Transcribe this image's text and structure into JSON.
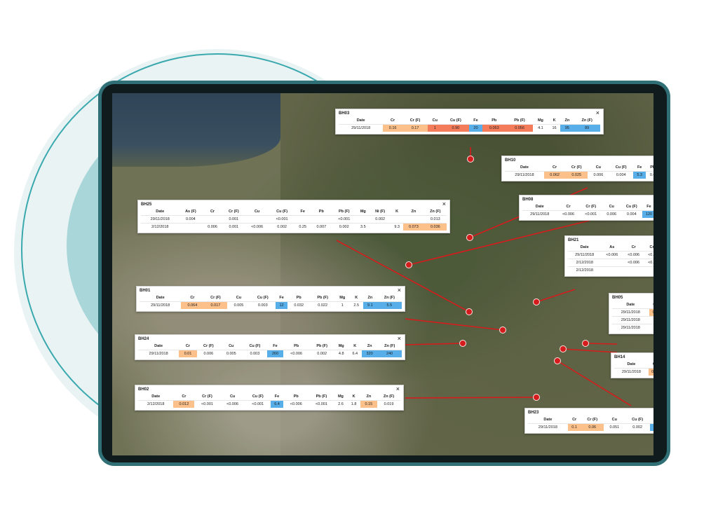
{
  "popups": [
    {
      "id": "BH03",
      "columns": [
        "Date",
        "Cr",
        "Cr (F)",
        "Cu",
        "Cu (F)",
        "Fe",
        "Pb",
        "Pb (F)",
        "Mg",
        "K",
        "Zn",
        "Zn (F)"
      ],
      "rows": [
        [
          "29/11/2018",
          "0.16",
          "0.17",
          "1",
          "0.90",
          "20",
          "0.063",
          "0.056",
          "4.1",
          "16",
          "95",
          "89"
        ]
      ],
      "colors": [
        [
          "",
          "orange",
          "orange",
          "red",
          "red",
          "blue",
          "red",
          "red",
          "",
          "",
          "blue",
          "blue"
        ]
      ]
    },
    {
      "id": "BH25",
      "columns": [
        "Date",
        "As (F)",
        "Cr",
        "Cr (F)",
        "Cu",
        "Cu (F)",
        "Fe",
        "Pb",
        "Pb (F)",
        "Mg",
        "Ni (F)",
        "K",
        "Zn",
        "Zn (F)"
      ],
      "rows": [
        [
          "29/11/2018",
          "0.004",
          "",
          "0.001",
          "",
          "<0.001",
          "",
          "",
          "<0.001",
          "",
          "0.002",
          "",
          "",
          "0.013"
        ],
        [
          "2/12/2018",
          "",
          "0.006",
          "0.001",
          "<0.006",
          "0.002",
          "0.25",
          "0.007",
          "0.002",
          "3.5",
          "",
          "9.3",
          "0.073",
          "0.036"
        ]
      ],
      "colors": [
        [
          "",
          "",
          "",
          "",
          "",
          "",
          "",
          "",
          "",
          "",
          "",
          "",
          "",
          ""
        ],
        [
          "",
          "",
          "",
          "",
          "",
          "",
          "",
          "",
          "",
          "",
          "",
          "",
          "orange",
          "orange"
        ]
      ]
    },
    {
      "id": "BH01",
      "columns": [
        "Date",
        "Cr",
        "Cr (F)",
        "Cu",
        "Cu (F)",
        "Fe",
        "Pb",
        "Pb (F)",
        "Mg",
        "K",
        "Zn",
        "Zn (F)"
      ],
      "rows": [
        [
          "29/11/2018",
          "0.064",
          "0.017",
          "0.005",
          "0.003",
          "12",
          "0.032",
          "0.022",
          "1",
          "2.5",
          "9.1",
          "5.5"
        ]
      ],
      "colors": [
        [
          "",
          "orange",
          "orange",
          "",
          "",
          "blue",
          "",
          "",
          "",
          "",
          "blue",
          "blue"
        ]
      ]
    },
    {
      "id": "BH24",
      "columns": [
        "Date",
        "Cr",
        "Cr (F)",
        "Cu",
        "Cu (F)",
        "Fe",
        "Pb",
        "Pb (F)",
        "Mg",
        "K",
        "Zn",
        "Zn (F)"
      ],
      "rows": [
        [
          "29/11/2018",
          "0.01",
          "0.006",
          "0.005",
          "0.003",
          "260",
          "<0.006",
          "0.002",
          "4.8",
          "6.4",
          "320",
          "240"
        ]
      ],
      "colors": [
        [
          "",
          "orange",
          "",
          "",
          "",
          "blue",
          "",
          "",
          "",
          "",
          "blue",
          "blue"
        ]
      ]
    },
    {
      "id": "BH02",
      "columns": [
        "Date",
        "Cr",
        "Cr (F)",
        "Cu",
        "Cu (F)",
        "Fe",
        "Pb",
        "Pb (F)",
        "Mg",
        "K",
        "Zn",
        "Zn (F)"
      ],
      "rows": [
        [
          "2/12/2018",
          "0.012",
          "<0.001",
          "<0.006",
          "<0.001",
          "6.4",
          "<0.006",
          "<0.001",
          "2.6",
          "1.8",
          "0.15",
          "0.019"
        ]
      ],
      "colors": [
        [
          "",
          "orange",
          "",
          "",
          "",
          "blue",
          "",
          "",
          "",
          "",
          "orange",
          ""
        ]
      ]
    },
    {
      "id": "BH10",
      "columns": [
        "Date",
        "Cr",
        "Cr (F)",
        "Cu",
        "Cu (F)",
        "Fe",
        "Pb"
      ],
      "rows": [
        [
          "29/11/2018",
          "0.062",
          "0.025",
          "0.006",
          "0.004",
          "5.3",
          "0.0"
        ]
      ],
      "colors": [
        [
          "",
          "orange",
          "orange",
          "",
          "",
          "blue",
          ""
        ]
      ]
    },
    {
      "id": "BH08",
      "columns": [
        "Date",
        "Cr",
        "Cr (F)",
        "Cu",
        "Cu (F)",
        "Fe"
      ],
      "rows": [
        [
          "29/11/2018",
          "<0.006",
          "<0.001",
          "0.006",
          "0.004",
          "120"
        ]
      ],
      "colors": [
        [
          "",
          "",
          "",
          "",
          "",
          "blue"
        ]
      ]
    },
    {
      "id": "BH21",
      "columns": [
        "Date",
        "As",
        "Cr",
        "Cr"
      ],
      "rows": [
        [
          "29/11/2018",
          "<0.006",
          "<0.006",
          "<0.0"
        ],
        [
          "2/12/2018",
          "",
          "<0.006",
          "<0.0"
        ],
        [
          "2/12/2018",
          "",
          "",
          ""
        ]
      ],
      "colors": [
        [
          "",
          "",
          "",
          ""
        ],
        [
          "",
          "",
          "",
          ""
        ],
        [
          "",
          "",
          "",
          ""
        ]
      ]
    },
    {
      "id": "BH05",
      "columns": [
        "Date",
        "Cr"
      ],
      "rows": [
        [
          "29/11/2018",
          "0.4"
        ],
        [
          "29/11/2018",
          ""
        ],
        [
          "29/11/2018",
          ""
        ]
      ],
      "colors": [
        [
          "",
          "orange"
        ],
        [
          "",
          ""
        ],
        [
          "",
          ""
        ]
      ]
    },
    {
      "id": "BH14",
      "columns": [
        "Date",
        "C"
      ],
      "rows": [
        [
          "29/11/2018",
          "0.2"
        ]
      ],
      "colors": [
        [
          "",
          "orange"
        ]
      ]
    },
    {
      "id": "BH23",
      "columns": [
        "Date",
        "Cr",
        "Cr (F)",
        "Cu",
        "Cu (F)",
        "Fe"
      ],
      "rows": [
        [
          "29/11/2018",
          "0.1",
          "0.06",
          "0.051",
          "0.002",
          "17"
        ]
      ],
      "colors": [
        [
          "",
          "orange",
          "orange",
          "",
          "",
          "blue"
        ]
      ]
    }
  ],
  "close_glyph": "×",
  "highlight_colors": {
    "orange": "#fcc08a",
    "red": "#f47c5a",
    "blue": "#57aee8"
  },
  "marker_color": "#d51c1c"
}
